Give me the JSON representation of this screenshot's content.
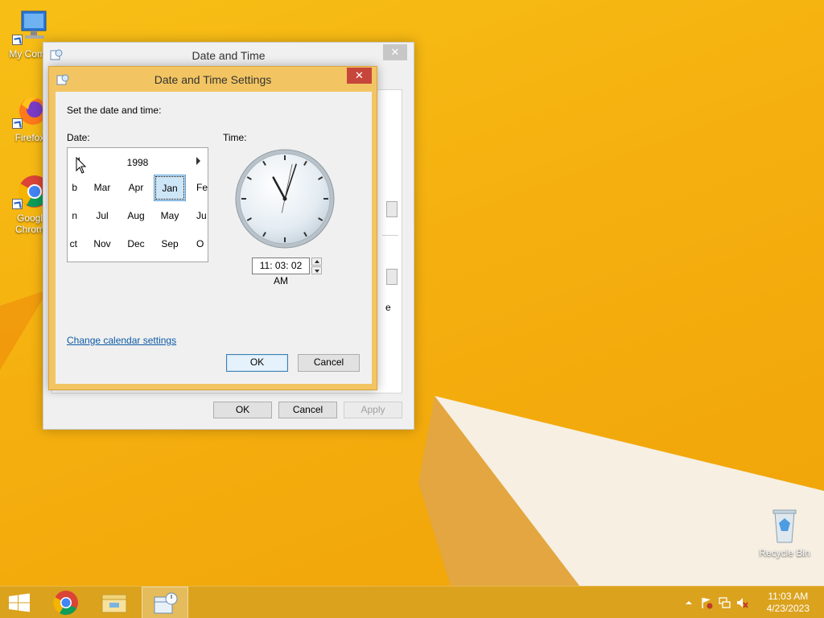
{
  "desktop": {
    "icons": [
      {
        "label": "My Comp"
      },
      {
        "label": "Firefox"
      },
      {
        "label": "Googl Chrom"
      },
      {
        "label": "Recycle Bin"
      }
    ]
  },
  "outer_window": {
    "title": "Date and Time",
    "close_label": "✕",
    "ok_label": "OK",
    "cancel_label": "Cancel",
    "apply_label": "Apply",
    "peek_text": "e"
  },
  "dialog": {
    "title": "Date and Time Settings",
    "close_label": "✕",
    "instruction": "Set the date and time:",
    "date_label": "Date:",
    "time_label": "Time:",
    "calendar": {
      "year": "1998",
      "selected_month": "Jan",
      "rows": [
        [
          "b",
          "Mar",
          "Apr",
          "Jan",
          "Fe"
        ],
        [
          "n",
          "Jul",
          "Aug",
          "May",
          "Ju"
        ],
        [
          "ct",
          "Nov",
          "Dec",
          "Sep",
          "O"
        ]
      ]
    },
    "time_value": "11: 03: 02 AM",
    "change_calendar_link": "Change calendar settings",
    "ok_label": "OK",
    "cancel_label": "Cancel"
  },
  "clock": {
    "hour": 11,
    "minute": 3,
    "second": 2
  },
  "taskbar": {
    "clock_time": "11:03 AM",
    "clock_date": "4/23/2023",
    "colors": {
      "accent": "#dba21e",
      "desktop": "#f5b00f"
    }
  }
}
